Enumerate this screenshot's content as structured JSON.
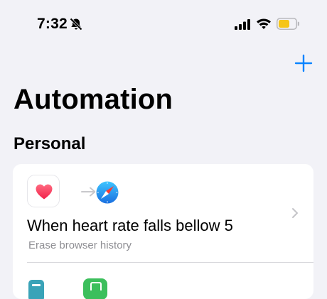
{
  "status_bar": {
    "time": "7:32",
    "battery_color": "#f5c518"
  },
  "header": {
    "add_icon": "plus-icon",
    "accent_color": "#0a84ff",
    "title": "Automation"
  },
  "section": {
    "title": "Personal"
  },
  "automations": [
    {
      "trigger_icon": "health-heart-icon",
      "action_icon": "safari-compass-icon",
      "title": "When heart rate falls bellow 5",
      "subtitle": "Erase browser history"
    },
    {
      "trigger_icon": "notes-icon",
      "action_icon": "home-icon"
    }
  ]
}
